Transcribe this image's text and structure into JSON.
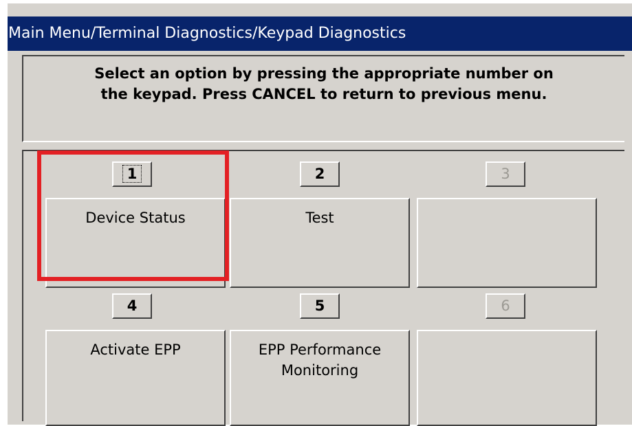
{
  "window": {
    "title": "Main Menu/Terminal Diagnostics/Keypad Diagnostics"
  },
  "instruction": {
    "text": "Select an option by pressing the appropriate number on\nthe keypad.  Press CANCEL to return to previous menu."
  },
  "options": [
    {
      "key": "1",
      "label": "Device Status",
      "enabled": true,
      "focused": true
    },
    {
      "key": "2",
      "label": "Test",
      "enabled": true,
      "focused": false
    },
    {
      "key": "3",
      "label": "",
      "enabled": false,
      "focused": false
    },
    {
      "key": "4",
      "label": "Activate EPP",
      "enabled": true,
      "focused": false
    },
    {
      "key": "5",
      "label": "EPP Performance\nMonitoring",
      "enabled": true,
      "focused": false
    },
    {
      "key": "6",
      "label": "",
      "enabled": false,
      "focused": false
    }
  ],
  "colors": {
    "titlebar_bg": "#08246b",
    "window_bg": "#d6d3ce",
    "highlight_border": "#e32024",
    "disabled_text": "#9c9a94"
  }
}
